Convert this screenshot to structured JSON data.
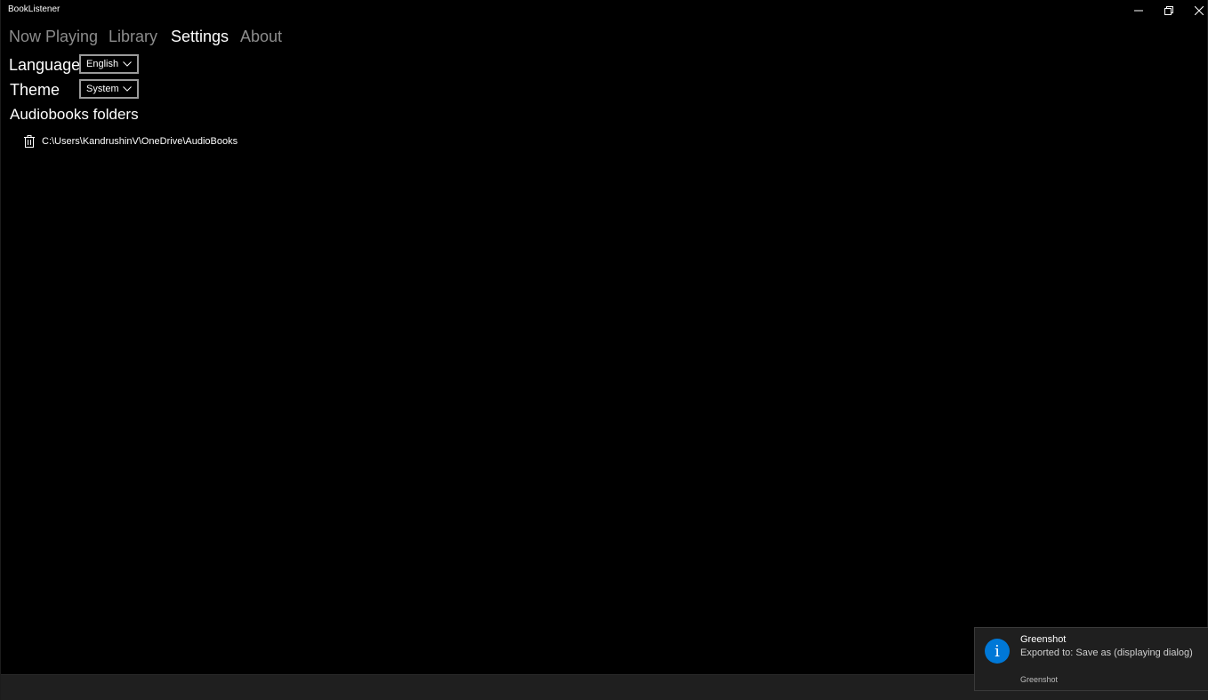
{
  "window": {
    "title": "BookListener",
    "controls": {
      "minimize_icon": "minimize-icon",
      "restore_icon": "restore-icon",
      "close_icon": "close-icon"
    }
  },
  "nav": {
    "items": [
      {
        "label": "Now Playing",
        "active": false
      },
      {
        "label": "Library",
        "active": false
      },
      {
        "label": "Settings",
        "active": true
      },
      {
        "label": "About",
        "active": false
      }
    ]
  },
  "settings": {
    "language": {
      "label": "Language",
      "value": "English"
    },
    "theme": {
      "label": "Theme",
      "value": "System"
    },
    "folders": {
      "title": "Audiobooks folders",
      "items": [
        {
          "path": "C:\\Users\\KandrushinV\\OneDrive\\AudioBooks",
          "icon": "trash-icon"
        }
      ]
    }
  },
  "toast": {
    "icon": "info-icon",
    "icon_glyph": "i",
    "title": "Greenshot",
    "body": "Exported to: Save as (displaying dialog)",
    "source": "Greenshot"
  },
  "colors": {
    "background": "#000000",
    "text": "#ffffff",
    "inactive_nav": "#8c8c8c",
    "accent": "#0078d7",
    "combo_border": "#9a9a9a"
  }
}
